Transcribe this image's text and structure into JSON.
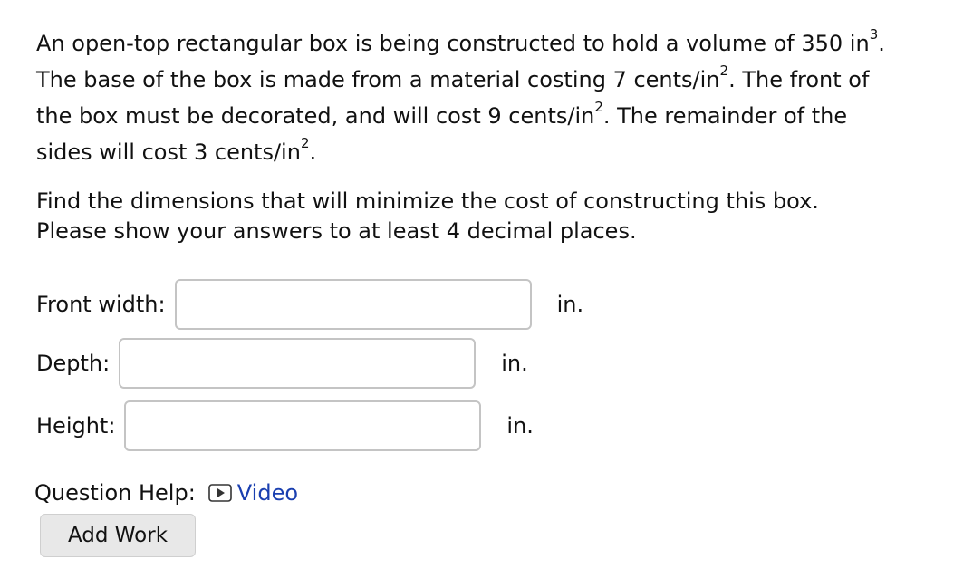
{
  "problem": {
    "line1_text": "An open-top rectangular box is being constructed to hold a volume of 350 in",
    "line1_sup": "3",
    "line1_end": ".",
    "line2_text": "The base of the box is made from a material costing 7 cents/in",
    "line2_sup": "2",
    "line2_end": ". The front of",
    "line3_text": "the box must be decorated, and will cost 9 cents/in",
    "line3_sup": "2",
    "line3_end": ". The remainder of the",
    "line4_text": "sides will cost 3 cents/in",
    "line4_sup": "2",
    "line4_end": "."
  },
  "instructions": {
    "line1": "Find the dimensions that will minimize the cost of constructing this box.",
    "line2": "Please show your answers to at least 4 decimal places."
  },
  "fields": {
    "front_width": {
      "label": "Front width:",
      "value": "",
      "unit": "in."
    },
    "depth": {
      "label": "Depth:",
      "value": "",
      "unit": "in."
    },
    "height": {
      "label": "Height:",
      "value": "",
      "unit": "in."
    }
  },
  "help": {
    "label": "Question Help:",
    "video_label": "Video",
    "video_icon": "play-video-icon"
  },
  "add_work_label": "Add Work",
  "colors": {
    "link": "#1a3fb0",
    "input_border": "#c4c4c4",
    "button_bg": "#e8e8e8"
  }
}
